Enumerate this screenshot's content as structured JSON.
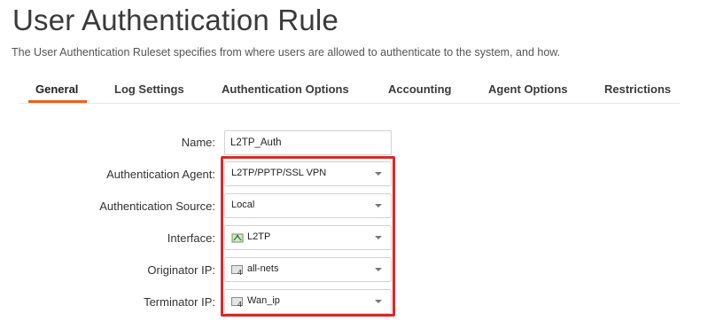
{
  "page": {
    "title": "User Authentication Rule",
    "description": "The User Authentication Ruleset specifies from where users are allowed to authenticate to the system, and how."
  },
  "tabs": [
    {
      "label": "General",
      "active": true
    },
    {
      "label": "Log Settings",
      "active": false
    },
    {
      "label": "Authentication Options",
      "active": false
    },
    {
      "label": "Accounting",
      "active": false
    },
    {
      "label": "Agent Options",
      "active": false
    },
    {
      "label": "Restrictions",
      "active": false
    }
  ],
  "form": {
    "name": {
      "label": "Name:",
      "value": "L2TP_Auth"
    },
    "authentication_agent": {
      "label": "Authentication Agent:",
      "value": "L2TP/PPTP/SSL VPN"
    },
    "authentication_source": {
      "label": "Authentication Source:",
      "value": "Local"
    },
    "interface": {
      "label": "Interface:",
      "value": "L2TP",
      "icon": "interface-icon"
    },
    "originator_ip": {
      "label": "Originator IP:",
      "value": "all-nets",
      "icon": "address-object-icon"
    },
    "terminator_ip": {
      "label": "Terminator IP:",
      "value": "Wan_ip",
      "icon": "address-object-icon"
    }
  },
  "colors": {
    "accent": "#e8621a",
    "highlight": "#d42b2b"
  }
}
